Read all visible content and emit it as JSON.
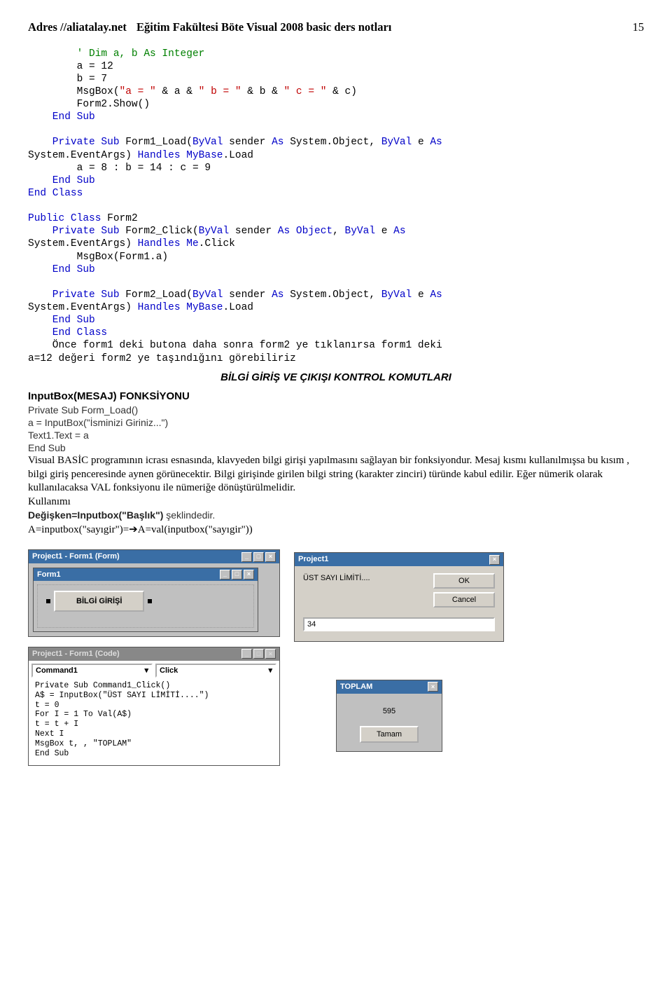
{
  "header": {
    "address_label": "Adres //aliatalay.net",
    "title": "Eğitim Fakültesi Böte Visual 2008 basic ders notları",
    "page_number": "15"
  },
  "code_block_1": {
    "l1a": "        ' Dim a, b As Integer",
    "l2": "        a = 12",
    "l3": "        b = 7",
    "l4a": "        MsgBox(",
    "l4b": "\"a = \"",
    "l4c": " & a & ",
    "l4d": "\" b = \"",
    "l4e": " & b & ",
    "l4f": "\" c = \"",
    "l4g": " & c)",
    "l5": "        Form2.Show()",
    "l6": "    End Sub",
    "l8a": "    Private",
    "l8b": " Sub",
    "l8c": " Form1_Load(",
    "l8d": "ByVal",
    "l8e": " sender ",
    "l8f": "As",
    "l8g": " System.Object, ",
    "l8h": "ByVal",
    "l8i": " e ",
    "l8j": "As",
    "l9a": "System.EventArgs) ",
    "l9b": "Handles",
    "l9c": " MyBase",
    "l9d": ".Load",
    "l10": "        a = 8 : b = 14 : c = 9",
    "l11": "    End Sub",
    "l12": "End Class",
    "l14a": "Public",
    "l14b": " Class",
    "l14c": " Form2",
    "l15a": "    Private",
    "l15b": " Sub",
    "l15c": " Form2_Click(",
    "l15d": "ByVal",
    "l15e": " sender ",
    "l15f": "As",
    "l15g": " Object",
    "l15h": ", ",
    "l15i": "ByVal",
    "l15j": " e ",
    "l15k": "As",
    "l16a": "System.EventArgs) ",
    "l16b": "Handles",
    "l16c": " Me",
    "l16d": ".Click",
    "l17": "        MsgBox(Form1.a)",
    "l18": "    End Sub",
    "l20a": "    Private",
    "l20b": " Sub",
    "l20c": " Form2_Load(",
    "l20d": "ByVal",
    "l20e": " sender ",
    "l20f": "As",
    "l20g": " System.Object, ",
    "l20h": "ByVal",
    "l20i": " e ",
    "l20j": "As",
    "l21a": "System.EventArgs) ",
    "l21b": "Handles",
    "l21c": " MyBase",
    "l21d": ".Load",
    "l22": "    End Sub",
    "l23": "    End Class",
    "note": "    Önce form1 deki butona daha sonra form2 ye tıklanırsa form1 deki\na=12 değeri form2 ye taşındığını görebiliriz"
  },
  "section": {
    "title": "BİLGİ GİRİŞ VE ÇIKIŞI KONTROL KOMUTLARI",
    "func_heading": "InputBox(MESAJ) FONKSİYONU",
    "pl1": "Private Sub Form_Load()",
    "pl2": "a = InputBox(\"İsminizi Giriniz...\")",
    "pl3": "Text1.Text = a",
    "pl4": "End Sub",
    "para": "Visual BASİC programının icrası esnasında, klavyeden bilgi girişi yapılmasını sağlayan bir fonksiyondur. Mesaj kısmı kullanılmışsa bu  kısım , bilgi giriş penceresinde aynen görünecektir. Bilgi girişinde girilen bilgi string (karakter zinciri) türünde kabul edilir. Eğer nümerik olarak kullanılacaksa VAL fonksiyonu ile nümeriğe dönüştürülmelidir.",
    "usage_label": "Kullanımı",
    "usage_bold": "Değişken=Inputbox(\"Başlık\")",
    "usage_tail": " şeklindedir.",
    "usage_line2_a": "A=inputbox(\"sayıgir\")=",
    "usage_line2_arrow": "➔",
    "usage_line2_b": "A=val(inputbox(\"sayıgir\"))"
  },
  "shots": {
    "form_title": "Project1 - Form1 (Form)",
    "form_inner_title": "Form1",
    "button_label": "BİLGİ GİRİŞİ",
    "dlg_title": "Project1",
    "dlg_prompt": "ÜST SAYI LİMİTİ....",
    "dlg_ok": "OK",
    "dlg_cancel": "Cancel",
    "dlg_value": "34",
    "code_title": "Project1 - Form1 (Code)",
    "combo_left": "Command1",
    "combo_right": "Click",
    "ide_l1": "Private Sub Command1_Click()",
    "ide_l2": "A$ = InputBox(\"ÜST SAYI LİMİTİ....\")",
    "ide_l3": "t = 0",
    "ide_l4": "For I = 1 To Val(A$)",
    "ide_l5": "t = t + I",
    "ide_l6": "Next I",
    "ide_l7": "MsgBox t, , \"TOPLAM\"",
    "ide_l8": "End Sub",
    "msg_title": "TOPLAM",
    "msg_value": "595",
    "msg_ok": "Tamam"
  }
}
